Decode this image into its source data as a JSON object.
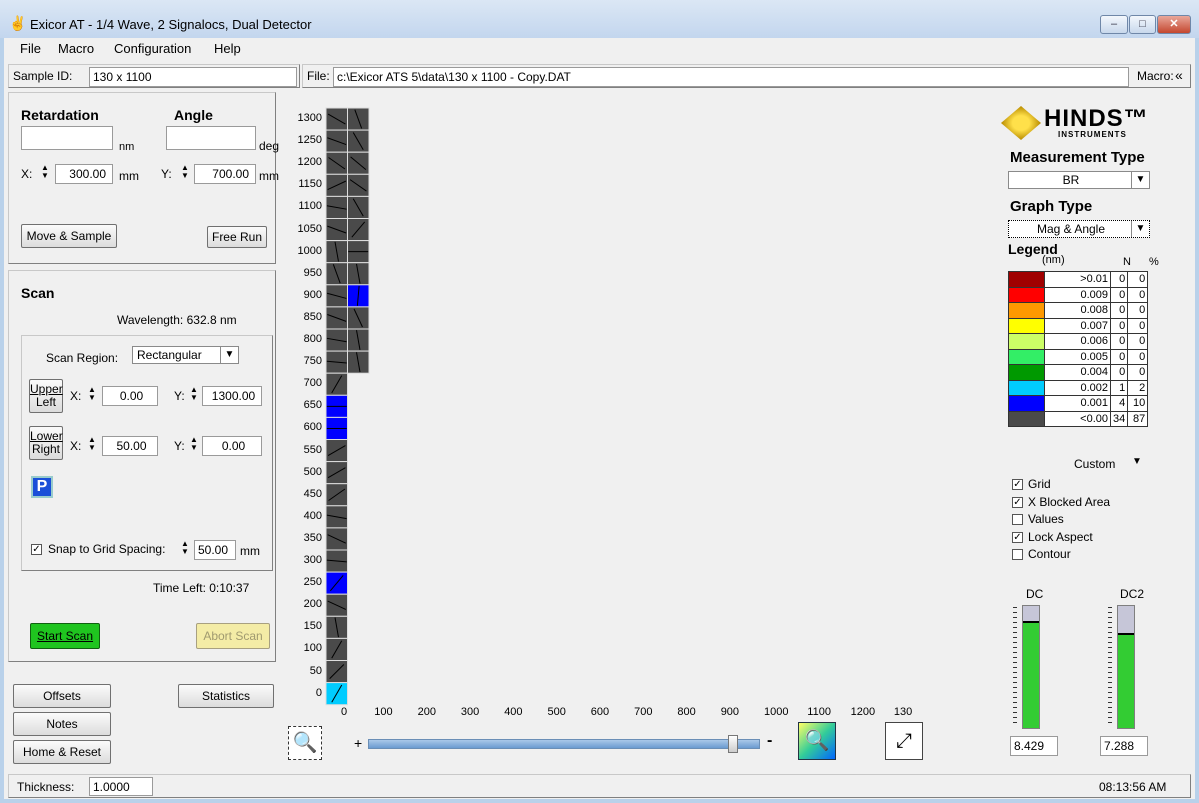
{
  "window": {
    "title": "Exicor AT - 1/4 Wave, 2 Signalocs, Dual Detector",
    "min": "–",
    "max": "□",
    "close": "✕"
  },
  "menu": [
    {
      "label": "File"
    },
    {
      "label": "Macro"
    },
    {
      "label": "Configuration"
    },
    {
      "label": "Help"
    }
  ],
  "top": {
    "sample_id_label": "Sample ID:",
    "sample_id": "130 x 1100",
    "file_label": "File:",
    "file": "c:\\Exicor ATS 5\\data\\130 x 1100 - Copy.DAT",
    "macro_label": "Macro:",
    "macro_icon": "«"
  },
  "position": {
    "retardation_label": "Retardation",
    "angle_label": "Angle",
    "nm_unit": "nm",
    "deg_unit": "deg",
    "x_label": "X:",
    "x_value": "300.00",
    "x_unit": "mm",
    "y_label": "Y:",
    "y_value": "700.00",
    "y_unit": "mm",
    "move_sample": "Move & Sample",
    "free_run": "Free Run"
  },
  "scan": {
    "title": "Scan",
    "wavelength": "Wavelength: 632.8 nm",
    "region_label": "Scan Region:",
    "region": "Rectangular",
    "upper_left_1": "Upper",
    "upper_left_2": "Left",
    "lower_right_1": "Lower",
    "lower_right_2": "Right",
    "ul_x": "0.00",
    "ul_y": "1300.00",
    "lr_x": "50.00",
    "lr_y": "0.00",
    "x_label": "X:",
    "y_label": "Y:",
    "p_icon": "P",
    "snap_label": "Snap to Grid Spacing:",
    "snap_value": "50.00",
    "snap_unit": "mm",
    "time_left": "Time Left:  0:10:37",
    "start": "Start Scan",
    "abort": "Abort Scan"
  },
  "bottom_buttons": {
    "offsets": "Offsets",
    "statistics": "Statistics",
    "notes": "Notes",
    "home_reset": "Home & Reset"
  },
  "status": {
    "thickness_label": "Thickness:",
    "thickness": "1.0000",
    "time": "08:13:56 AM"
  },
  "map": {
    "y_ticks": [
      "1300",
      "1250",
      "1200",
      "1150",
      "1100",
      "1050",
      "1000",
      "950",
      "900",
      "850",
      "800",
      "750",
      "700",
      "650",
      "600",
      "550",
      "500",
      "450",
      "400",
      "350",
      "300",
      "250",
      "200",
      "150",
      "100",
      "50",
      "0"
    ],
    "x_ticks": [
      "0",
      "100",
      "200",
      "300",
      "400",
      "500",
      "600",
      "700",
      "800",
      "900",
      "1000",
      "1100",
      "1200",
      "130"
    ],
    "plus": "+",
    "minus": "-",
    "cells": [
      {
        "col": 0,
        "row": 0,
        "color": "#4a4a4a",
        "angle": -30
      },
      {
        "col": 1,
        "row": 0,
        "color": "#4a4a4a",
        "angle": -70
      },
      {
        "col": 0,
        "row": 1,
        "color": "#4a4a4a",
        "angle": -20
      },
      {
        "col": 1,
        "row": 1,
        "color": "#4a4a4a",
        "angle": -60
      },
      {
        "col": 0,
        "row": 2,
        "color": "#4a4a4a",
        "angle": -35
      },
      {
        "col": 1,
        "row": 2,
        "color": "#4a4a4a",
        "angle": -40
      },
      {
        "col": 0,
        "row": 3,
        "color": "#4a4a4a",
        "angle": 25
      },
      {
        "col": 1,
        "row": 3,
        "color": "#4a4a4a",
        "angle": -35
      },
      {
        "col": 0,
        "row": 4,
        "color": "#4a4a4a",
        "angle": -10
      },
      {
        "col": 1,
        "row": 4,
        "color": "#4a4a4a",
        "angle": -60
      },
      {
        "col": 0,
        "row": 5,
        "color": "#4a4a4a",
        "angle": -20
      },
      {
        "col": 1,
        "row": 5,
        "color": "#4a4a4a",
        "angle": 50
      },
      {
        "col": 0,
        "row": 6,
        "color": "#4a4a4a",
        "angle": -80
      },
      {
        "col": 1,
        "row": 6,
        "color": "#4a4a4a",
        "angle": 0
      },
      {
        "col": 0,
        "row": 7,
        "color": "#4a4a4a",
        "angle": -70
      },
      {
        "col": 1,
        "row": 7,
        "color": "#4a4a4a",
        "angle": -80
      },
      {
        "col": 0,
        "row": 8,
        "color": "#4a4a4a",
        "angle": -15
      },
      {
        "col": 1,
        "row": 8,
        "color": "#0000ff",
        "angle": 85
      },
      {
        "col": 0,
        "row": 9,
        "color": "#4a4a4a",
        "angle": -20
      },
      {
        "col": 1,
        "row": 9,
        "color": "#4a4a4a",
        "angle": -65
      },
      {
        "col": 0,
        "row": 10,
        "color": "#4a4a4a",
        "angle": -10
      },
      {
        "col": 1,
        "row": 10,
        "color": "#4a4a4a",
        "angle": -80
      },
      {
        "col": 0,
        "row": 11,
        "color": "#4a4a4a",
        "angle": -5
      },
      {
        "col": 1,
        "row": 11,
        "color": "#4a4a4a",
        "angle": -80
      },
      {
        "col": 0,
        "row": 12,
        "color": "#4a4a4a",
        "angle": 60
      },
      {
        "col": 0,
        "row": 13,
        "color": "#0000ff",
        "angle": 0
      },
      {
        "col": 0,
        "row": 14,
        "color": "#0000ff",
        "angle": 0
      },
      {
        "col": 0,
        "row": 15,
        "color": "#4a4a4a",
        "angle": 30
      },
      {
        "col": 0,
        "row": 16,
        "color": "#4a4a4a",
        "angle": 30
      },
      {
        "col": 0,
        "row": 17,
        "color": "#4a4a4a",
        "angle": 35
      },
      {
        "col": 0,
        "row": 18,
        "color": "#4a4a4a",
        "angle": -10
      },
      {
        "col": 0,
        "row": 19,
        "color": "#4a4a4a",
        "angle": -25
      },
      {
        "col": 0,
        "row": 20,
        "color": "#4a4a4a",
        "angle": -5
      },
      {
        "col": 0,
        "row": 21,
        "color": "#0000ff",
        "angle": 50
      },
      {
        "col": 0,
        "row": 22,
        "color": "#4a4a4a",
        "angle": -25
      },
      {
        "col": 0,
        "row": 23,
        "color": "#4a4a4a",
        "angle": -80
      },
      {
        "col": 0,
        "row": 24,
        "color": "#4a4a4a",
        "angle": 60
      },
      {
        "col": 0,
        "row": 25,
        "color": "#4a4a4a",
        "angle": 45
      },
      {
        "col": 0,
        "row": 26,
        "color": "#00ccff",
        "angle": 60
      }
    ]
  },
  "right": {
    "logo_text": "HINDS™",
    "logo_sub": "INSTRUMENTS",
    "measurement_type_label": "Measurement Type",
    "measurement_type": "BR",
    "graph_type_label": "Graph Type",
    "graph_type": "Mag & Angle",
    "legend_label": "Legend",
    "legend_unit": "(nm)",
    "legend_n": "N",
    "legend_pct": "%",
    "legend": [
      {
        "color": "#a00000",
        "value": ">0.01",
        "n": "0",
        "pct": "0"
      },
      {
        "color": "#ff0000",
        "value": "0.009",
        "n": "0",
        "pct": "0"
      },
      {
        "color": "#ff9900",
        "value": "0.008",
        "n": "0",
        "pct": "0"
      },
      {
        "color": "#ffff00",
        "value": "0.007",
        "n": "0",
        "pct": "0"
      },
      {
        "color": "#ccff66",
        "value": "0.006",
        "n": "0",
        "pct": "0"
      },
      {
        "color": "#33ee66",
        "value": "0.005",
        "n": "0",
        "pct": "0"
      },
      {
        "color": "#009900",
        "value": "0.004",
        "n": "0",
        "pct": "0"
      },
      {
        "color": "#00ccff",
        "value": "0.002",
        "n": "1",
        "pct": "2"
      },
      {
        "color": "#0000ff",
        "value": "0.001",
        "n": "4",
        "pct": "10"
      },
      {
        "color": "#4a4a4a",
        "value": "<0.00",
        "n": "34",
        "pct": "87"
      }
    ],
    "custom": "Custom",
    "options": [
      {
        "label": "Grid",
        "checked": true
      },
      {
        "label": "X Blocked Area",
        "checked": true
      },
      {
        "label": "Values",
        "checked": false
      },
      {
        "label": "Lock Aspect",
        "checked": true
      },
      {
        "label": "Contour",
        "checked": false
      }
    ],
    "dc_label": "DC",
    "dc2_label": "DC2",
    "dc_value": "8.429",
    "dc2_value": "7.288",
    "dc_level": 0.85,
    "dc2_level": 0.75
  }
}
